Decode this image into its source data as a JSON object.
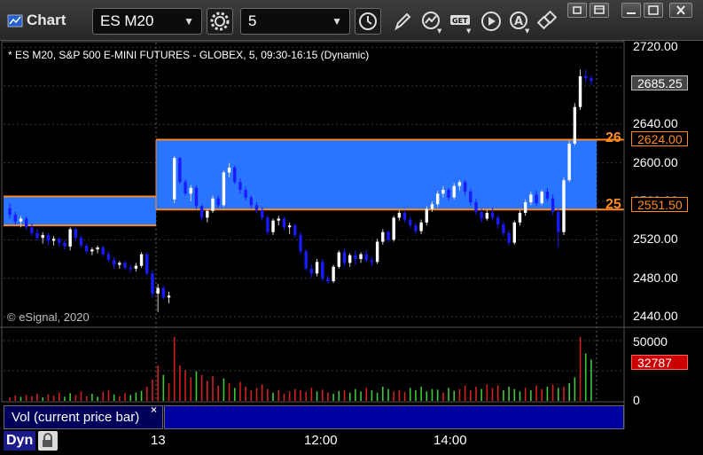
{
  "toolbar": {
    "title": "Chart",
    "symbol": "ES M20",
    "interval": "5",
    "icons": [
      "gear-icon",
      "clock-icon",
      "pencil-icon",
      "chart-study-icon",
      "get-icon",
      "play-icon",
      "alert-icon",
      "link-icon"
    ]
  },
  "chart": {
    "header": "* ES M20, S&P 500 E-MINI FUTURES - GLOBEX, 5, 09:30-16:15 (Dynamic)",
    "copyright": "© eSignal, 2020",
    "price_axis": [
      "2720.00",
      "2680.00",
      "2640.00",
      "2600.00",
      "2560.00",
      "2520.00",
      "2480.00",
      "2440.00"
    ],
    "last_price": "2685.25",
    "upper_level": "2624.00",
    "lower_level": "2551.50",
    "upper_level_label": "26",
    "lower_level_label": "25"
  },
  "volume": {
    "axis": [
      "50000",
      "25000",
      "0"
    ],
    "last_volume": "32787",
    "legend": "Vol (current price bar)",
    "close_glyph": "×"
  },
  "time_axis": {
    "labels": [
      "13",
      "12:00",
      "14:00"
    ],
    "dyn_label": "Dyn"
  },
  "colors": {
    "background": "#000000",
    "up_candle": "#ffffff",
    "down_candle": "#1a1aff",
    "band_fill": "#2a75ff",
    "level_line": "#ff8a1e",
    "volume_up": "#3ec83e",
    "volume_down": "#d02020",
    "last_volume_tag": "#cc0000"
  },
  "chart_data": {
    "type": "candlestick",
    "symbol": "ES M20",
    "levels": [
      2624.0,
      2551.5
    ],
    "last": 2685.25,
    "ylim": [
      2430,
      2725
    ],
    "ohlc": [
      [
        2553,
        2558,
        2542,
        2546
      ],
      [
        2546,
        2549,
        2536,
        2539
      ],
      [
        2539,
        2545,
        2533,
        2542
      ],
      [
        2542,
        2544,
        2530,
        2533
      ],
      [
        2533,
        2537,
        2524,
        2527
      ],
      [
        2527,
        2531,
        2519,
        2522
      ],
      [
        2522,
        2528,
        2516,
        2525
      ],
      [
        2525,
        2527,
        2515,
        2519
      ],
      [
        2519,
        2524,
        2514,
        2521
      ],
      [
        2521,
        2523,
        2513,
        2517
      ],
      [
        2517,
        2520,
        2510,
        2513
      ],
      [
        2513,
        2533,
        2509,
        2531
      ],
      [
        2531,
        2533,
        2519,
        2522
      ],
      [
        2522,
        2524,
        2512,
        2514
      ],
      [
        2514,
        2516,
        2506,
        2508
      ],
      [
        2508,
        2512,
        2504,
        2510
      ],
      [
        2510,
        2514,
        2506,
        2512
      ],
      [
        2512,
        2514,
        2503,
        2505
      ],
      [
        2505,
        2508,
        2497,
        2499
      ],
      [
        2499,
        2502,
        2490,
        2494
      ],
      [
        2494,
        2498,
        2490,
        2496
      ],
      [
        2496,
        2498,
        2489,
        2491
      ],
      [
        2491,
        2494,
        2486,
        2490
      ],
      [
        2490,
        2496,
        2487,
        2493
      ],
      [
        2493,
        2507,
        2491,
        2505
      ],
      [
        2505,
        2507,
        2483,
        2485
      ],
      [
        2485,
        2488,
        2460,
        2464
      ],
      [
        2464,
        2474,
        2445,
        2470
      ],
      [
        2470,
        2472,
        2458,
        2460
      ],
      [
        2460,
        2466,
        2454,
        2462
      ],
      [
        2562,
        2607,
        2558,
        2605
      ],
      [
        2605,
        2606,
        2578,
        2580
      ],
      [
        2580,
        2583,
        2566,
        2568
      ],
      [
        2568,
        2577,
        2560,
        2574
      ],
      [
        2574,
        2576,
        2552,
        2555
      ],
      [
        2555,
        2557,
        2540,
        2543
      ],
      [
        2543,
        2552,
        2538,
        2550
      ],
      [
        2550,
        2566,
        2548,
        2563
      ],
      [
        2563,
        2566,
        2553,
        2556
      ],
      [
        2556,
        2592,
        2554,
        2590
      ],
      [
        2590,
        2600,
        2585,
        2595
      ],
      [
        2595,
        2597,
        2578,
        2580
      ],
      [
        2580,
        2584,
        2568,
        2572
      ],
      [
        2572,
        2575,
        2561,
        2564
      ],
      [
        2564,
        2566,
        2553,
        2556
      ],
      [
        2556,
        2559,
        2548,
        2551
      ],
      [
        2551,
        2554,
        2540,
        2543
      ],
      [
        2543,
        2546,
        2525,
        2528
      ],
      [
        2528,
        2542,
        2525,
        2540
      ],
      [
        2540,
        2545,
        2535,
        2542
      ],
      [
        2542,
        2544,
        2530,
        2533
      ],
      [
        2533,
        2538,
        2526,
        2535
      ],
      [
        2535,
        2537,
        2522,
        2525
      ],
      [
        2525,
        2528,
        2505,
        2508
      ],
      [
        2508,
        2510,
        2488,
        2490
      ],
      [
        2490,
        2494,
        2481,
        2485
      ],
      [
        2485,
        2500,
        2482,
        2497
      ],
      [
        2497,
        2500,
        2477,
        2480
      ],
      [
        2480,
        2483,
        2474,
        2477
      ],
      [
        2477,
        2494,
        2475,
        2492
      ],
      [
        2492,
        2509,
        2490,
        2507
      ],
      [
        2507,
        2511,
        2493,
        2496
      ],
      [
        2496,
        2506,
        2492,
        2504
      ],
      [
        2504,
        2509,
        2494,
        2500
      ],
      [
        2500,
        2507,
        2496,
        2505
      ],
      [
        2505,
        2509,
        2497,
        2499
      ],
      [
        2499,
        2502,
        2493,
        2497
      ],
      [
        2497,
        2521,
        2495,
        2518
      ],
      [
        2518,
        2531,
        2515,
        2528
      ],
      [
        2528,
        2530,
        2517,
        2520
      ],
      [
        2520,
        2545,
        2518,
        2543
      ],
      [
        2543,
        2551,
        2540,
        2548
      ],
      [
        2548,
        2551,
        2538,
        2541
      ],
      [
        2541,
        2544,
        2532,
        2535
      ],
      [
        2535,
        2538,
        2526,
        2529
      ],
      [
        2529,
        2541,
        2526,
        2538
      ],
      [
        2538,
        2555,
        2535,
        2552
      ],
      [
        2552,
        2560,
        2549,
        2557
      ],
      [
        2557,
        2571,
        2554,
        2568
      ],
      [
        2568,
        2576,
        2564,
        2572
      ],
      [
        2572,
        2574,
        2561,
        2564
      ],
      [
        2564,
        2579,
        2562,
        2576
      ],
      [
        2576,
        2582,
        2571,
        2580
      ],
      [
        2580,
        2582,
        2566,
        2570
      ],
      [
        2570,
        2573,
        2556,
        2559
      ],
      [
        2559,
        2563,
        2546,
        2549
      ],
      [
        2549,
        2552,
        2538,
        2542
      ],
      [
        2542,
        2551,
        2540,
        2548
      ],
      [
        2548,
        2553,
        2540,
        2543
      ],
      [
        2543,
        2546,
        2532,
        2536
      ],
      [
        2536,
        2539,
        2524,
        2527
      ],
      [
        2527,
        2530,
        2514,
        2517
      ],
      [
        2517,
        2540,
        2515,
        2538
      ],
      [
        2538,
        2551,
        2535,
        2548
      ],
      [
        2548,
        2562,
        2545,
        2559
      ],
      [
        2559,
        2570,
        2556,
        2567
      ],
      [
        2567,
        2571,
        2555,
        2558
      ],
      [
        2558,
        2572,
        2556,
        2570
      ],
      [
        2570,
        2574,
        2560,
        2563
      ],
      [
        2563,
        2567,
        2546,
        2549
      ],
      [
        2549,
        2552,
        2512,
        2528
      ],
      [
        2528,
        2585,
        2525,
        2582
      ],
      [
        2582,
        2623,
        2580,
        2620
      ],
      [
        2620,
        2662,
        2618,
        2658
      ],
      [
        2658,
        2697,
        2655,
        2690
      ],
      [
        2690,
        2697,
        2684,
        2688
      ],
      [
        2688,
        2691,
        2681,
        2685
      ]
    ],
    "volume": [
      [
        3000,
        1
      ],
      [
        4500,
        1
      ],
      [
        3500,
        0
      ],
      [
        5000,
        1
      ],
      [
        4000,
        1
      ],
      [
        6000,
        1
      ],
      [
        3000,
        0
      ],
      [
        5500,
        1
      ],
      [
        4500,
        1
      ],
      [
        7000,
        1
      ],
      [
        3500,
        0
      ],
      [
        6500,
        0
      ],
      [
        5000,
        1
      ],
      [
        8000,
        1
      ],
      [
        4000,
        1
      ],
      [
        6000,
        0
      ],
      [
        3500,
        0
      ],
      [
        7500,
        1
      ],
      [
        9000,
        1
      ],
      [
        5500,
        0
      ],
      [
        4000,
        1
      ],
      [
        6500,
        1
      ],
      [
        5000,
        0
      ],
      [
        7000,
        0
      ],
      [
        8500,
        0
      ],
      [
        12000,
        1
      ],
      [
        18000,
        1
      ],
      [
        30000,
        1
      ],
      [
        22000,
        0
      ],
      [
        15000,
        1
      ],
      [
        54000,
        1
      ],
      [
        30000,
        1
      ],
      [
        26000,
        1
      ],
      [
        20000,
        1
      ],
      [
        25000,
        0
      ],
      [
        22000,
        1
      ],
      [
        17000,
        1
      ],
      [
        21000,
        1
      ],
      [
        13000,
        1
      ],
      [
        19000,
        0
      ],
      [
        15000,
        1
      ],
      [
        11000,
        0
      ],
      [
        16000,
        1
      ],
      [
        12000,
        1
      ],
      [
        9000,
        1
      ],
      [
        11000,
        1
      ],
      [
        14000,
        1
      ],
      [
        10000,
        1
      ],
      [
        7000,
        0
      ],
      [
        9000,
        1
      ],
      [
        6000,
        1
      ],
      [
        8000,
        1
      ],
      [
        10000,
        1
      ],
      [
        9000,
        1
      ],
      [
        7500,
        1
      ],
      [
        11000,
        1
      ],
      [
        8000,
        0
      ],
      [
        9500,
        1
      ],
      [
        7000,
        1
      ],
      [
        6000,
        0
      ],
      [
        8500,
        0
      ],
      [
        9000,
        1
      ],
      [
        7000,
        0
      ],
      [
        10000,
        0
      ],
      [
        8000,
        0
      ],
      [
        11000,
        1
      ],
      [
        9000,
        0
      ],
      [
        7000,
        0
      ],
      [
        12000,
        0
      ],
      [
        10000,
        0
      ],
      [
        8000,
        1
      ],
      [
        9000,
        1
      ],
      [
        7500,
        1
      ],
      [
        11000,
        0
      ],
      [
        9000,
        0
      ],
      [
        12000,
        0
      ],
      [
        8000,
        0
      ],
      [
        10000,
        0
      ],
      [
        9500,
        0
      ],
      [
        7000,
        1
      ],
      [
        11000,
        0
      ],
      [
        8500,
        0
      ],
      [
        10000,
        1
      ],
      [
        13000,
        1
      ],
      [
        9000,
        1
      ],
      [
        12000,
        1
      ],
      [
        10000,
        0
      ],
      [
        14000,
        1
      ],
      [
        11000,
        1
      ],
      [
        13000,
        1
      ],
      [
        9000,
        0
      ],
      [
        12000,
        0
      ],
      [
        10000,
        0
      ],
      [
        8000,
        0
      ],
      [
        11000,
        1
      ],
      [
        9000,
        0
      ],
      [
        13000,
        1
      ],
      [
        10000,
        1
      ],
      [
        12000,
        0
      ],
      [
        14000,
        1
      ],
      [
        11000,
        0
      ],
      [
        12000,
        1
      ],
      [
        15000,
        0
      ],
      [
        20000,
        0
      ],
      [
        54000,
        1
      ],
      [
        40000,
        0
      ],
      [
        35000,
        0
      ]
    ]
  }
}
